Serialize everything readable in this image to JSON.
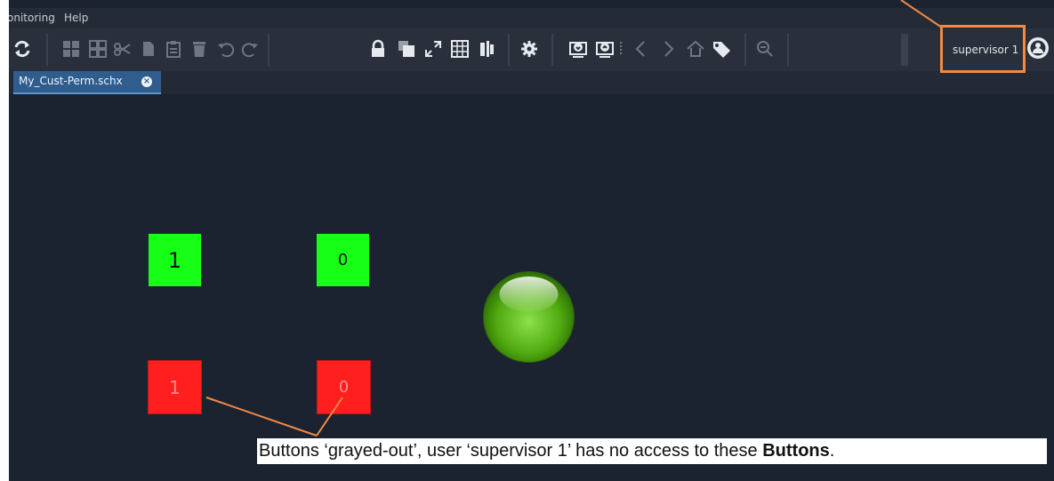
{
  "menu": {
    "items": [
      "onitoring",
      "Help"
    ]
  },
  "toolbar": {
    "icons": [
      "refresh-icon",
      "layout-grid-icon",
      "grid-outline-icon",
      "cut-icon",
      "copy-icon",
      "paste-icon",
      "delete-icon",
      "undo-icon",
      "redo-icon",
      "lock-icon",
      "layers-icon",
      "expand-icon",
      "grid-table-icon",
      "align-icon",
      "gear-icon",
      "download-panel-icon",
      "upload-panel-icon",
      "chevron-left-icon",
      "chevron-right-icon",
      "home-icon",
      "tag-icon",
      "zoom-out-icon"
    ]
  },
  "user": {
    "name": "supervisor 1"
  },
  "tab": {
    "label": "My_Cust-Perm.schx"
  },
  "panel": {
    "button_top_left": "1",
    "button_top_right": "0",
    "button_bottom_left": "1",
    "button_bottom_right": "0"
  },
  "annotation": {
    "caption_part1": "Buttons ‘grayed-out’, user ‘supervisor 1’ has no access to these ",
    "caption_bold": "Buttons",
    "caption_end": "."
  },
  "colors": {
    "accent": "#f08a45",
    "tab_active": "#2f5d8e",
    "enabled_button": "#17ff17",
    "disabled_button": "#ff1f1f",
    "indicator": "#58b815"
  }
}
